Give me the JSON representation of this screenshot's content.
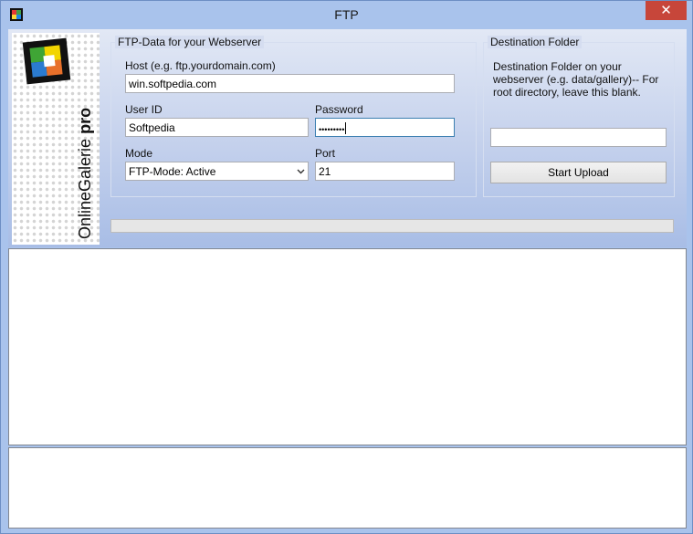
{
  "window": {
    "title": "FTP",
    "close_glyph": "✕"
  },
  "logo": {
    "brand": "OnlineGalerie",
    "edition": "pro"
  },
  "ftp": {
    "legend": "FTP-Data for your Webserver",
    "host_label": "Host (e.g. ftp.yourdomain.com)",
    "host_value": "win.softpedia.com",
    "userid_label": "User ID",
    "userid_value": "Softpedia",
    "password_label": "Password",
    "password_value": "•••••••••",
    "mode_label": "Mode",
    "mode_value": "FTP-Mode: Active",
    "port_label": "Port",
    "port_value": "21"
  },
  "destination": {
    "legend": "Destination Folder",
    "description": "Destination Folder on your webserver (e.g. data/gallery)-- For root directory, leave this blank.",
    "folder_value": "",
    "upload_label": "Start Upload"
  },
  "progress": {
    "fraction": 0
  },
  "icons": {
    "app": "app-icon",
    "close": "close-icon",
    "dropdown": "chevron-down-icon"
  },
  "colors": {
    "window_bg": "#a9c3ec",
    "close_button": "#c7463a",
    "header_gradient_top": "#e2e8f5",
    "header_gradient_bottom": "#a8bde6"
  }
}
